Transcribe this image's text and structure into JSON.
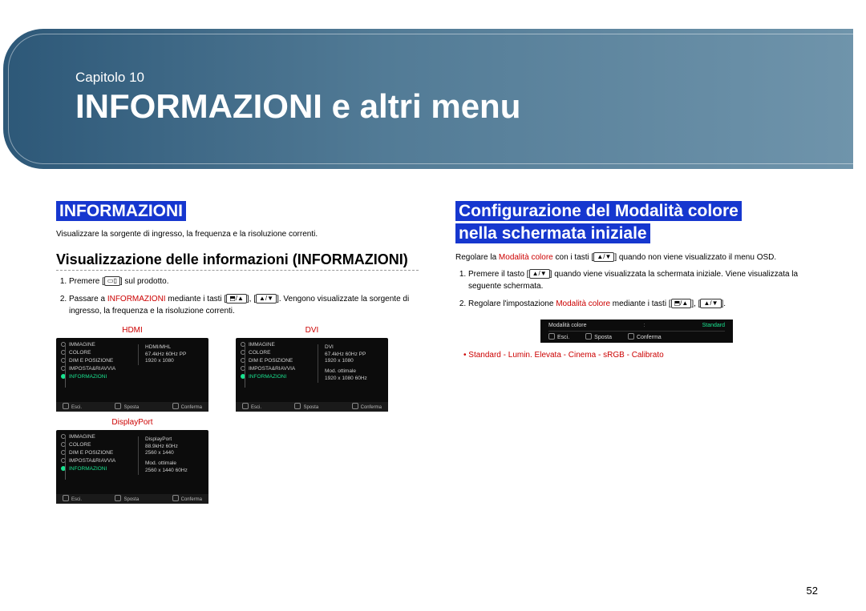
{
  "banner": {
    "chapter": "Capitolo 10",
    "title": "INFORMAZIONI e altri menu"
  },
  "left": {
    "heading": "INFORMAZIONI",
    "desc": "Visualizzare la sorgente di ingresso, la frequenza e la risoluzione correnti.",
    "subhead": "Visualizzazione delle informazioni (INFORMAZIONI)",
    "step1_a": "Premere [",
    "step1_b": "] sul prodotto.",
    "step2_a": "Passare a ",
    "step2_red": "INFORMAZIONI",
    "step2_b": " mediante i tasti [",
    "step2_c": "], [",
    "step2_d": "]. Vengono visualizzate la sorgente di ingresso, la frequenza e la risoluzione correnti.",
    "labels": {
      "hdmi": "HDMI",
      "dvi": "DVI",
      "dp": "DisplayPort"
    },
    "osd_menu": {
      "m1": "IMMAGINE",
      "m2": "COLORE",
      "m3": "DIM E POSIZIONE",
      "m4": "IMPOSTA&RIAVVIA",
      "m5": "INFORMAZIONI"
    },
    "osd_info": {
      "hdmi": {
        "l1": "HDMI/MHL",
        "l2": "67.4kHz  60Hz PP",
        "l3": "1920 x 1080"
      },
      "dvi": {
        "l1": "DVI",
        "l2": "67.4kHz  60Hz PP",
        "l3": "1920 x 1080",
        "l4": "Mod. ottimale",
        "l5": "1920 x 1080   60Hz"
      },
      "dp": {
        "l1": "DisplayPort",
        "l2": "88.9kHz 60Hz",
        "l3": "2560 x 1440",
        "l4": "Mod. ottimale",
        "l5": "2560 x 1440   60Hz"
      }
    },
    "bar": {
      "exit": "Esci.",
      "move": "Sposta",
      "ok": "Conferma"
    }
  },
  "right": {
    "heading1": "Configurazione del Modalità colore",
    "heading2": "nella schermata iniziale",
    "lead_a": "Regolare la ",
    "lead_red": "Modalità colore",
    "lead_b": " con i tasti [",
    "lead_c": "] quando non viene visualizzato il menu OSD.",
    "step1_a": "Premere il tasto [",
    "step1_b": "] quando viene visualizzata la schermata iniziale. Viene visualizzata la seguente schermata.",
    "step2_a": "Regolare l'impostazione ",
    "step2_red": "Modalità colore",
    "step2_b": " mediante i tasti [",
    "step2_c": "], [",
    "step2_d": "].",
    "osd": {
      "name": "Modalità colore",
      "value": "Standard",
      "exit": "Esci.",
      "move": "Sposta",
      "ok": "Conferma"
    },
    "modes": "Standard - Lumin. Elevata - Cinema - sRGB - Calibrato"
  },
  "keys": {
    "menu": "▭▯",
    "nav": "⬒/▲",
    "updown": "▲/▼"
  },
  "page": "52"
}
